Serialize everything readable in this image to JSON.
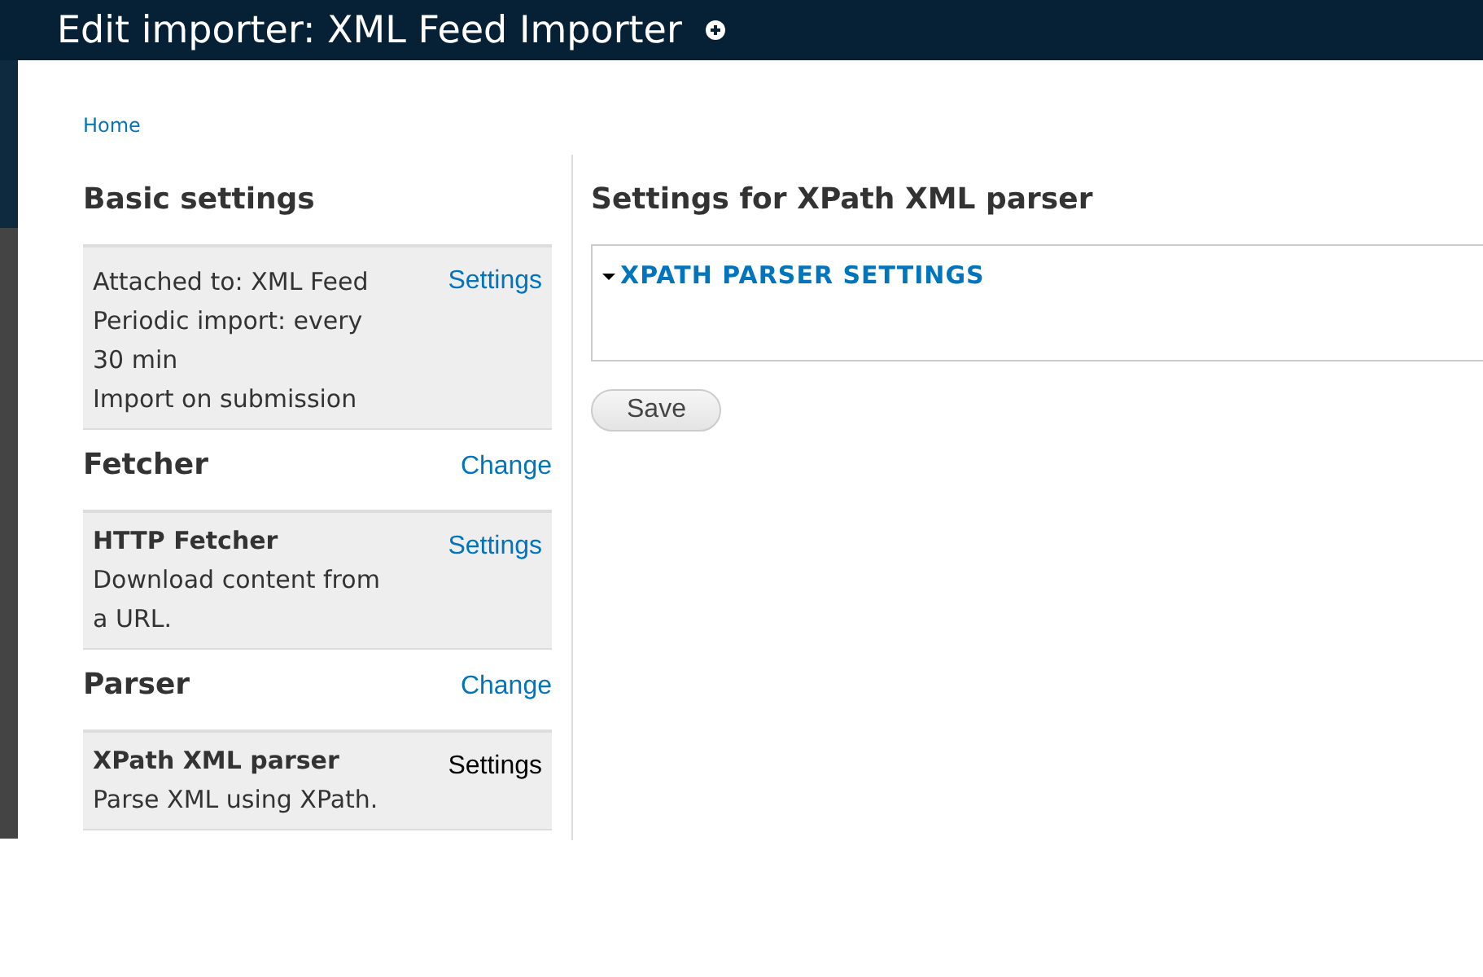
{
  "header": {
    "title": "Edit importer: XML Feed Importer"
  },
  "breadcrumb": [
    "Home"
  ],
  "sidebar": [
    {
      "heading": "Basic settings",
      "items": [
        {
          "lines": [
            "Attached to: XML Feed",
            "Periodic import: every 30 min",
            "Import on submission"
          ],
          "link": {
            "label": "Settings",
            "active": false
          }
        }
      ]
    },
    {
      "heading": "Fetcher",
      "change": "Change",
      "items": [
        {
          "title": "HTTP Fetcher",
          "lines": [
            "Download content from a URL."
          ],
          "link": {
            "label": "Settings",
            "active": false
          }
        }
      ]
    },
    {
      "heading": "Parser",
      "change": "Change",
      "items": [
        {
          "title": "XPath XML parser",
          "lines": [
            "Parse XML using XPath."
          ],
          "link": {
            "label": "Settings",
            "active": true
          }
        }
      ]
    }
  ],
  "main": {
    "heading": "Settings for XPath XML parser",
    "fieldset": {
      "legend": "XPATH PARSER SETTINGS",
      "expanded": true
    },
    "buttons": [
      "Save"
    ]
  }
}
